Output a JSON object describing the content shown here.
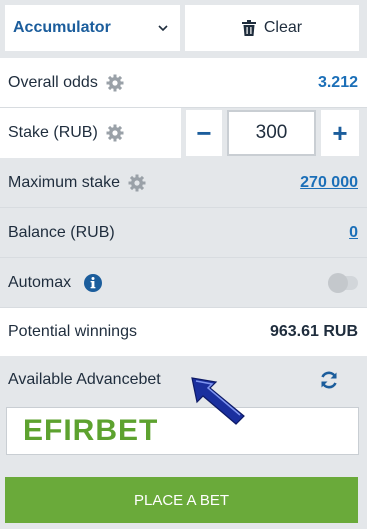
{
  "bet_type": {
    "selected": "Accumulator"
  },
  "clear_button": {
    "label": "Clear"
  },
  "overall_odds": {
    "label": "Overall odds",
    "value": "3.212"
  },
  "stake": {
    "label": "Stake (RUB)",
    "value": "300",
    "minus": "−",
    "plus": "+"
  },
  "maximum_stake": {
    "label": "Maximum stake",
    "value": "270 000"
  },
  "balance": {
    "label": "Balance (RUB)",
    "value": "0"
  },
  "automax": {
    "label": "Automax",
    "enabled": false
  },
  "potential_winnings": {
    "label": "Potential winnings",
    "value": "963.61 RUB"
  },
  "advancebet": {
    "label": "Available Advancebet"
  },
  "promo": {
    "code": "EFIRBET"
  },
  "place_bet": {
    "label": "PLACE A BET"
  },
  "colors": {
    "accent": "#1b6fb8",
    "place_button": "#6aaa3a",
    "promo_text": "#5da22f"
  }
}
